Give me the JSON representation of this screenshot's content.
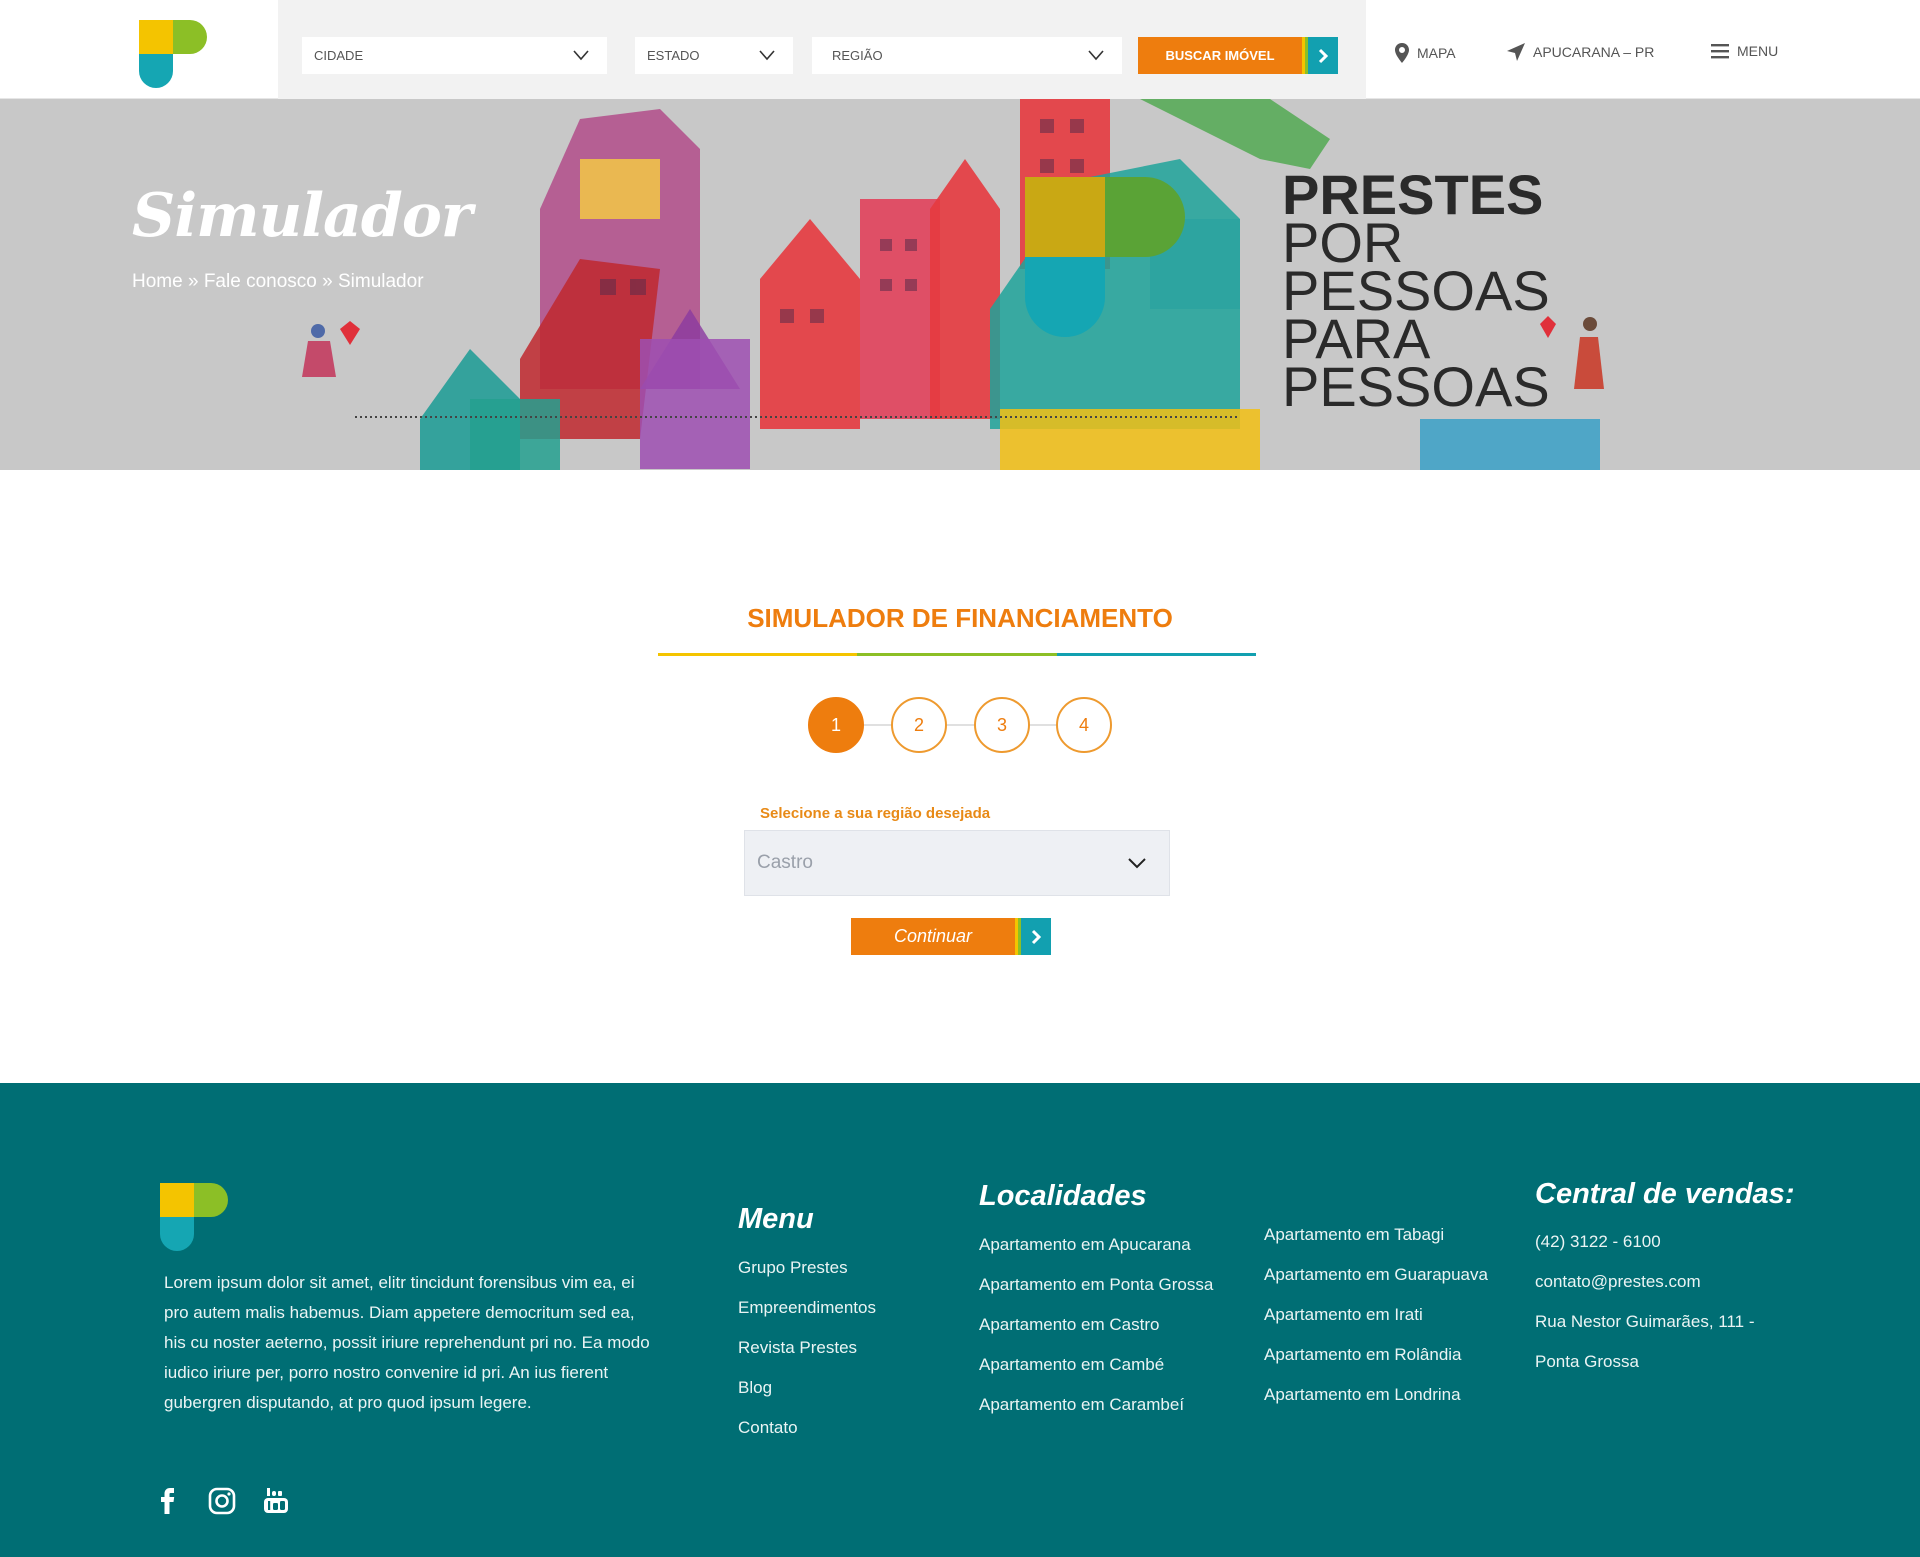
{
  "header": {
    "filters": [
      {
        "label": "CIDADE"
      },
      {
        "label": "ESTADO"
      },
      {
        "label": "REGIÃO"
      }
    ],
    "search_button": "BUSCAR IMÓVEL",
    "nav": {
      "map": "MAPA",
      "location": "APUCARANA – PR",
      "menu": "MENU"
    }
  },
  "hero": {
    "title": "Simulador",
    "breadcrumb": [
      "Home",
      "Fale conosco",
      "Simulador"
    ],
    "breadcrumb_sep": "»",
    "brand_lines": [
      "PRESTES",
      "POR",
      "PESSOAS",
      "PARA",
      "PESSOAS"
    ]
  },
  "simulator": {
    "title": "SIMULADOR DE FINANCIAMENTO",
    "steps": [
      "1",
      "2",
      "3",
      "4"
    ],
    "active_step": "1",
    "field_label": "Selecione a sua região desejada",
    "region_value": "Castro",
    "continue_button": "Continuar"
  },
  "footer": {
    "about": "Lorem ipsum dolor sit amet, elitr tincidunt forensibus vim ea, ei pro autem malis habemus. Diam appetere democritum sed ea, his cu noster aeterno, possit iriure reprehendunt pri no. Ea modo iudico iriure per, porro nostro convenire id pri. An ius fierent gubergren disputando, at pro quod ipsum legere.",
    "menu_title": "Menu",
    "menu_items": [
      "Grupo Prestes",
      "Empreendimentos",
      "Revista Prestes",
      "Blog",
      "Contato"
    ],
    "localidades_title": "Localidades",
    "localidades_col1": [
      "Apartamento em Apucarana",
      "Apartamento em Ponta Grossa",
      "Apartamento em Castro",
      "Apartamento em Cambé",
      "Apartamento em Carambeí"
    ],
    "localidades_col2": [
      "Apartamento em Tabagi",
      "Apartamento em Guarapuava",
      "Apartamento em Irati",
      "Apartamento em Rolândia",
      "Apartamento em Londrina"
    ],
    "central_title": "Central de vendas:",
    "central_items": [
      "(42)  3122 - 6100",
      "contato@prestes.com",
      "Rua Nestor Guimarães, 111 -",
      "Ponta Grossa"
    ],
    "social": [
      "facebook-icon",
      "instagram-icon",
      "youtube-icon"
    ]
  },
  "colors": {
    "orange": "#ee7d0e",
    "teal": "#12a0b0",
    "footer_bg": "#006e74",
    "yellow": "#f4c400",
    "green": "#8cbf26"
  }
}
